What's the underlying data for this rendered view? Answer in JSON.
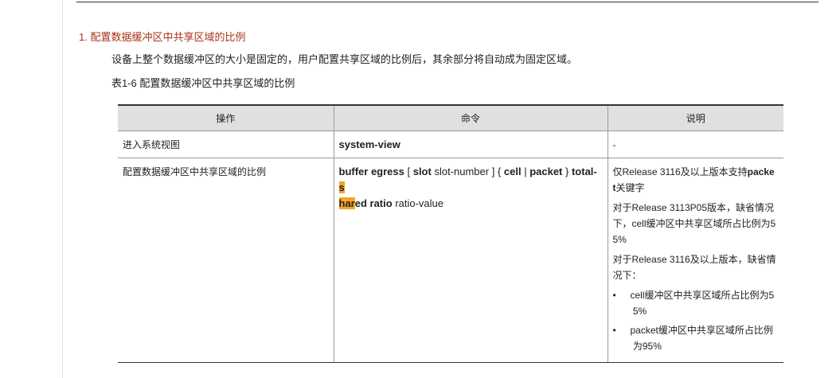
{
  "section": {
    "title": "1. 配置数据缓冲区中共享区域的比例"
  },
  "intro": "设备上整个数据缓冲区的大小是固定的，用户配置共享区域的比例后，其余部分将自动成为固定区域。",
  "caption": "表1-6 配置数据缓冲区中共享区域的比例",
  "table": {
    "headers": [
      "操作",
      "命令",
      "说明"
    ],
    "rows": [
      {
        "op": "进入系统视图",
        "cmd": "system-view",
        "note": "-"
      },
      {
        "op": "配置数据缓冲区中共享区域的比例",
        "cmd_parts": {
          "p1": "buffer egress",
          "p2": " [ ",
          "p3": "slot",
          "p4": " slot-number ] { ",
          "p5": "cell",
          "p6": " | ",
          "p7": "packet",
          "p8": " } ",
          "p9": "total-",
          "p10": "s",
          "p11": "har",
          "p12": "ed ratio",
          "p13": " ratio-value"
        },
        "notes": {
          "n1_a": "仅Release 3116及以上版本支持",
          "n1_b": "packe",
          "n1_c": "t",
          "n1_d": "关键字",
          "n2_a": "对于Release 3113P05版本，缺省情况下，cell缓冲区中共享区域所占比例为5",
          "n2_b": "5%",
          "n3": "对于Release 3116及以上版本，缺省情况下：",
          "b1_a": "cell缓冲区中共享区域所占比例为5",
          "b1_b": "5%",
          "b2_a": "packet缓冲区中共享区域所占比例",
          "b2_b": "为95%",
          "bullet_char": "•"
        }
      }
    ]
  },
  "colors": {
    "title": "#a8351b",
    "highlight": "#f5a623",
    "header_bg": "#e0e0e0"
  }
}
